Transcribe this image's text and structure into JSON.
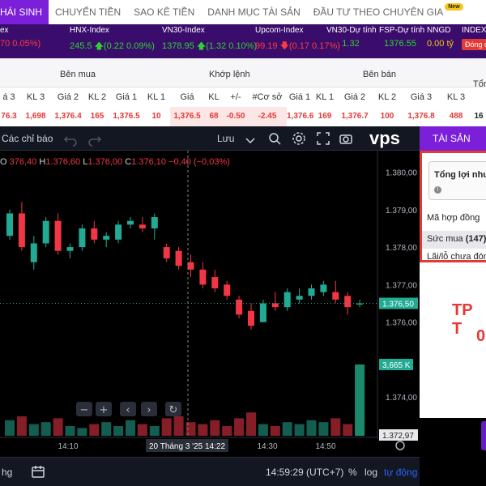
{
  "nav": {
    "tabs": [
      {
        "label": "HÁI SINH",
        "active": true
      },
      {
        "label": "CHUYỂN TIỀN"
      },
      {
        "label": "SAO KÊ TIỀN"
      },
      {
        "label": "DANH MỤC TÀI SẢN"
      },
      {
        "label": "ĐẦU TƯ THEO CHUYÊN GIA",
        "badge": "New"
      }
    ]
  },
  "indices": [
    {
      "name": "ex",
      "value": "70 0.05%)",
      "color": "red"
    },
    {
      "name": "HNX-Index",
      "value": "245.5",
      "change": "(0.22 0.09%)",
      "dir": "up"
    },
    {
      "name": "VN30-Index",
      "value": "1378.95",
      "change": "(1.32 0.10%)",
      "dir": "up"
    },
    {
      "name": "Upcom-Index",
      "value": "99.19",
      "change": "(0.17 0.17%)",
      "dir": "down"
    },
    {
      "name": "VN30-Dự tính",
      "value": "1.32",
      "color": "green"
    },
    {
      "name": "FSP-Dự tính",
      "value": "1376.55",
      "color": "green"
    },
    {
      "name": "NNGD",
      "value": "0.00 tỷ",
      "color": "yellow"
    },
    {
      "name": "INDEX",
      "badge": "Đóng cử"
    }
  ],
  "orderbook": {
    "groups": [
      "Bên mua",
      "Khớp lệnh",
      "Bên bán",
      "Tổn"
    ],
    "columns": [
      "á 3",
      "KL 3",
      "Giá 2",
      "KL 2",
      "Giá 1",
      "KL 1",
      "Giá",
      "KL",
      "+/-",
      "#Cơ sở",
      "Giá 1",
      "KL 1",
      "Giá 2",
      "KL 2",
      "Giá 3",
      "KL 3"
    ],
    "row": [
      "76.3",
      "1,698",
      "1,376.4",
      "165",
      "1,376.5",
      "10",
      "1,376.5",
      "68",
      "-0.50",
      "-2.45",
      "1,376.6",
      "169",
      "1,376.7",
      "100",
      "1,376.8",
      "488",
      "16"
    ]
  },
  "chart_toolbar": {
    "indicators_label": "Các chỉ báo",
    "save_label": "Lưu",
    "brand": "vps"
  },
  "chart_data": {
    "type": "candlestick",
    "ohlc_label": {
      "o": "376,40",
      "h": "1.376,60",
      "l": "1.376,00",
      "c": "1.376,10",
      "chg": "−0,40 (−0,03%)"
    },
    "price_ticks": [
      "1.380,00",
      "1.379,00",
      "1.378,00",
      "1.377,00",
      "1.376,00",
      "1.374,00",
      "1.372,97"
    ],
    "last_price_label": "1.376,50",
    "volume_label": "3,665 K",
    "x_ticks": [
      "14:10",
      "14:30",
      "14:50"
    ],
    "crosshair_label": "20 Tháng 3 '25  14:22",
    "ylim": [
      1373.4,
      1380.4
    ],
    "candles": [
      {
        "o": 1378.3,
        "h": 1379.0,
        "l": 1378.2,
        "c": 1378.9
      },
      {
        "o": 1378.9,
        "h": 1379.2,
        "l": 1377.9,
        "c": 1378.0
      },
      {
        "o": 1377.6,
        "h": 1378.3,
        "l": 1377.4,
        "c": 1378.1
      },
      {
        "o": 1378.1,
        "h": 1378.8,
        "l": 1378.0,
        "c": 1378.7
      },
      {
        "o": 1378.7,
        "h": 1378.9,
        "l": 1377.8,
        "c": 1377.9
      },
      {
        "o": 1377.9,
        "h": 1378.1,
        "l": 1377.7,
        "c": 1378.0
      },
      {
        "o": 1378.0,
        "h": 1378.6,
        "l": 1377.9,
        "c": 1378.5
      },
      {
        "o": 1378.5,
        "h": 1378.7,
        "l": 1378.1,
        "c": 1378.2
      },
      {
        "o": 1378.2,
        "h": 1378.4,
        "l": 1378.0,
        "c": 1378.3
      },
      {
        "o": 1378.2,
        "h": 1378.7,
        "l": 1378.1,
        "c": 1378.6
      },
      {
        "o": 1378.6,
        "h": 1378.8,
        "l": 1378.5,
        "c": 1378.7
      },
      {
        "o": 1378.6,
        "h": 1378.8,
        "l": 1378.4,
        "c": 1378.5
      },
      {
        "o": 1378.5,
        "h": 1378.9,
        "l": 1378.2,
        "c": 1378.8
      },
      {
        "o": 1378.0,
        "h": 1378.1,
        "l": 1377.6,
        "c": 1377.7
      },
      {
        "o": 1377.9,
        "h": 1378.0,
        "l": 1377.4,
        "c": 1377.5
      },
      {
        "o": 1377.6,
        "h": 1377.8,
        "l": 1377.2,
        "c": 1377.4
      },
      {
        "o": 1377.4,
        "h": 1377.6,
        "l": 1376.9,
        "c": 1377.0
      },
      {
        "o": 1377.2,
        "h": 1377.4,
        "l": 1376.8,
        "c": 1376.9
      },
      {
        "o": 1377.0,
        "h": 1377.1,
        "l": 1376.6,
        "c": 1376.7
      },
      {
        "o": 1376.6,
        "h": 1376.7,
        "l": 1376.1,
        "c": 1376.2
      },
      {
        "o": 1376.3,
        "h": 1376.5,
        "l": 1375.8,
        "c": 1375.9
      },
      {
        "o": 1376.0,
        "h": 1376.6,
        "l": 1376.0,
        "c": 1376.5
      },
      {
        "o": 1376.5,
        "h": 1376.8,
        "l": 1376.3,
        "c": 1376.4
      },
      {
        "o": 1376.4,
        "h": 1376.9,
        "l": 1376.3,
        "c": 1376.8
      },
      {
        "o": 1376.6,
        "h": 1376.9,
        "l": 1376.5,
        "c": 1376.7
      },
      {
        "o": 1376.7,
        "h": 1377.0,
        "l": 1376.6,
        "c": 1376.9
      },
      {
        "o": 1376.8,
        "h": 1377.1,
        "l": 1376.7,
        "c": 1377.0
      },
      {
        "o": 1376.8,
        "h": 1377.1,
        "l": 1376.5,
        "c": 1376.6
      },
      {
        "o": 1376.7,
        "h": 1376.8,
        "l": 1376.2,
        "c": 1376.4
      },
      {
        "o": 1376.5,
        "h": 1376.6,
        "l": 1376.4,
        "c": 1376.5
      }
    ],
    "volumes": [
      0.8,
      1.0,
      0.6,
      0.7,
      0.9,
      0.5,
      0.4,
      0.6,
      0.7,
      0.5,
      0.8,
      0.6,
      0.5,
      0.9,
      1.0,
      0.7,
      0.6,
      0.8,
      0.5,
      0.9,
      1.2,
      0.6,
      0.5,
      0.7,
      0.6,
      0.8,
      0.7,
      0.9,
      0.6,
      3.665
    ]
  },
  "bottombar": {
    "left_label": "hg",
    "time": "14:59:29 (UTC+7)",
    "pct": "%",
    "log": "log",
    "auto": "tự động"
  },
  "right_panel": {
    "tab": "TÀI SẢN",
    "card_title": "Tổng lợi nhu",
    "contract_label": "Mã hợp đồng",
    "buying_power_label": "Sức mua",
    "buying_power_count": "(147)",
    "unrealized_label": "Lãi/lỗ chưa đón",
    "big_text": "TP T",
    "big_text2": "0"
  }
}
